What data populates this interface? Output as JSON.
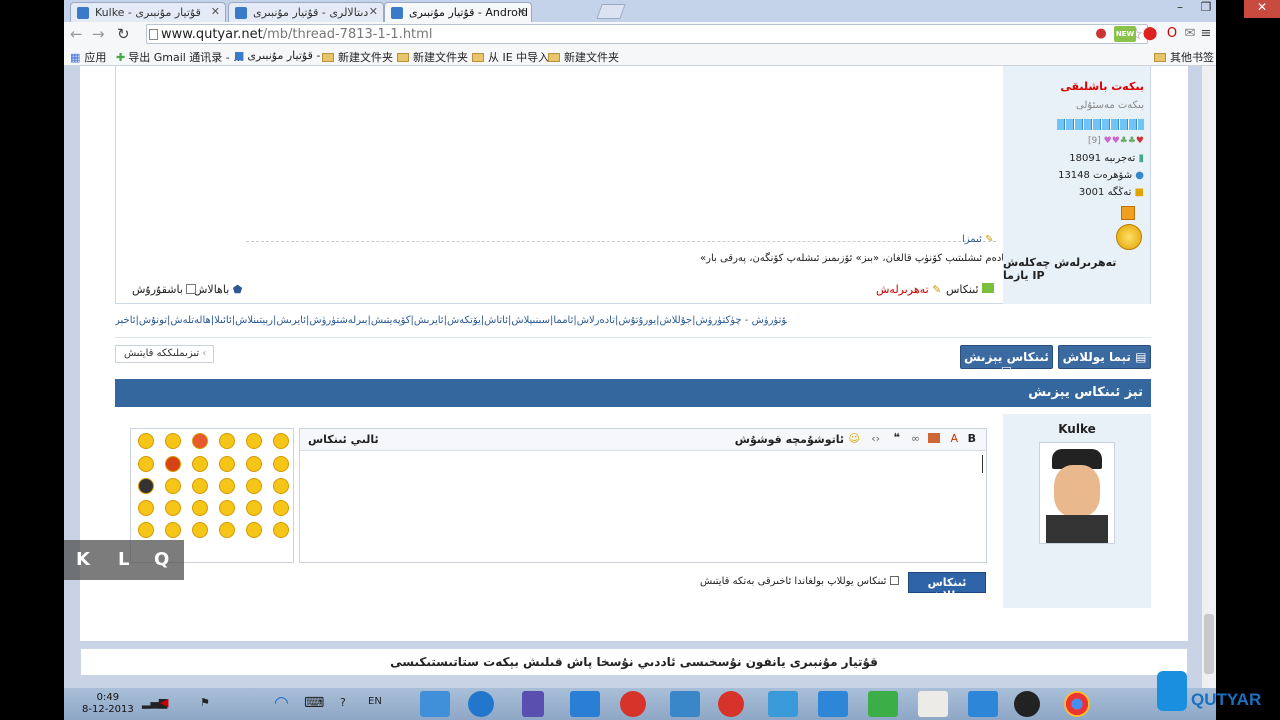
{
  "browser": {
    "tabs": [
      {
        "label": "Kulke - قۇتيار مۇنبىرى"
      },
      {
        "label": "دىتالالرى - قۇتيار مۇنبىرى"
      },
      {
        "label": "قۇتيار مۇنبىرى - Android"
      }
    ],
    "url_domain": "www.qutyar.net",
    "url_path": "/mb/thread-7813-1-1.html",
    "bookmarks": [
      {
        "label": "应用"
      },
      {
        "label": "导出 Gmail 通讯录 - ..."
      },
      {
        "label": "قۇتيار مۇنبىرى - ..."
      },
      {
        "label": "新建文件夹"
      },
      {
        "label": "新建文件夹"
      },
      {
        "label": "从 IE 中导入"
      },
      {
        "label": "新建文件夹"
      }
    ],
    "other_bookmarks": "其他书签",
    "ext_badge": "NEW"
  },
  "post": {
    "signature_label": "ئىمزا",
    "signature_text": "«ئۆ» ئادەم ئىشلىتىپ كۆنۈپ قالغان، «بىز» ئۆزىمىز ئىشلەپ كۆنگەن، پەرقى بار.",
    "reply_label": "ئىنكاس",
    "rate_label": "تەھرىرلەش",
    "report_label": "باھالاش",
    "top_label": "باشقۇرۇش"
  },
  "user": {
    "name": "بىكەت باشلىقى",
    "rank": "بىكەت مەسئۇلى",
    "stars_count": "[9]",
    "stats": [
      {
        "label": "تەجرىبە",
        "value": "18091"
      },
      {
        "label": "شۆھرەت",
        "value": "13148"
      },
      {
        "label": "تەڭگە",
        "value": "3001"
      }
    ],
    "actions": "تەھرىرلەش  چەكلەش  يازما  IP"
  },
  "tags": "تېما ئۆچۈرۈش|كۆتۈرۈش - چۈكتۈرۈش|جۇللاش|يورۇتۇش|تادەرلاش|ئامما|سىنىپلاش|ئاتاش|يۆتكەش|ئايرىش|كۆپەيتىش|بىرلەشتۈرۈش|ئايرىش|رېيتىنلاش|ئائىلا|ھالەتلەش|تونۇش|ئاخېر",
  "buttons": {
    "new_topic": "تېما يوللاش",
    "new_reply": "ئىنكاس يېزىش",
    "view_mode": "تىزىملىككە قايتىش"
  },
  "quick_reply": {
    "title": "تېز ئىنكاس يېزىش",
    "user": "Kulke",
    "editor_label": "ئالىي ئىنكاس",
    "toolbar_extra": "ئاتوشۇمچە قوشۇش",
    "submit": "ئىنكاس يوللاش",
    "checkbox_label": "ئىنكاس يوللاپ بولغاندا ئاخىرقى بەتكە قايتىش"
  },
  "footer": "قۇتيار مۇنبىرى   يانفون نۇسخىسى   ئاددىي نۇسخا   پاش قىلىش   بېكەت ستاتىستىكىسى",
  "overlay_keys": [
    "K",
    "L",
    "Q"
  ],
  "taskbar": {
    "time": "0:49",
    "date": "8-12-2013",
    "lang": "EN"
  },
  "logo": {
    "text": "QUTYAR"
  },
  "colors": {
    "accent": "#34679e",
    "username_red": "#d00000",
    "link_blue": "#2b5a94"
  }
}
